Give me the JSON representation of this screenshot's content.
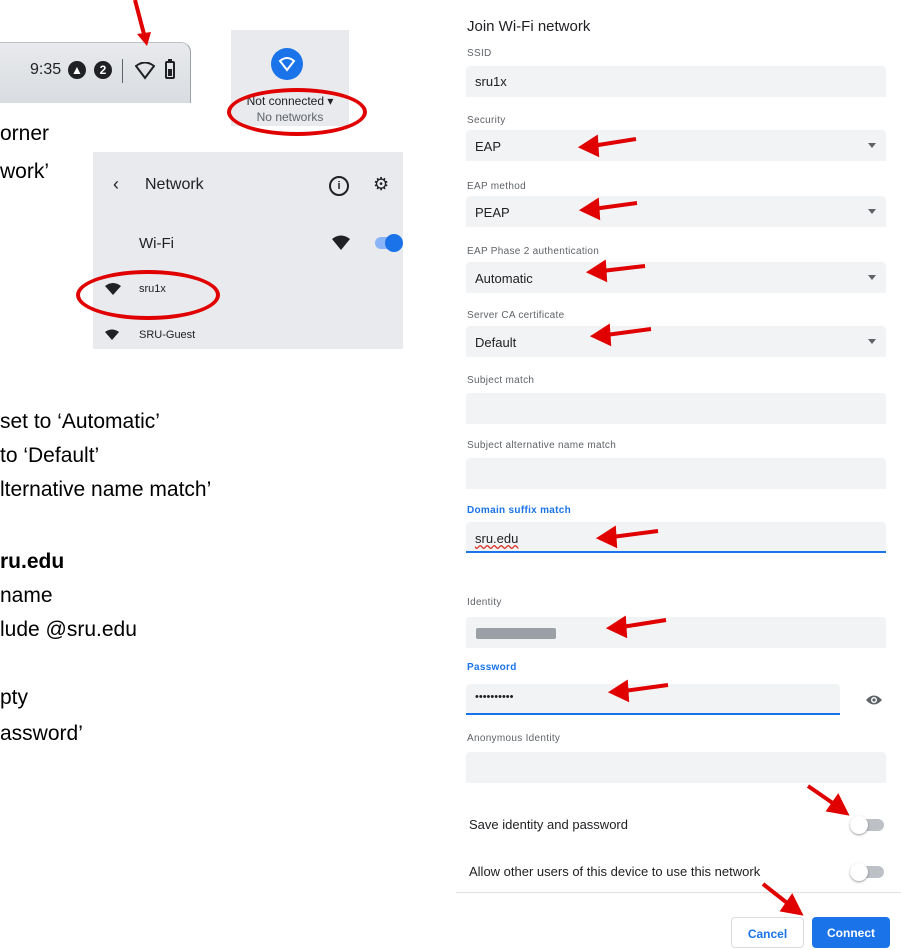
{
  "tray": {
    "time": "9:35",
    "badge1": "",
    "badge2": "2"
  },
  "popover": {
    "status": "Not connected",
    "sub": "No networks"
  },
  "network_panel": {
    "title": "Network",
    "wifi_label": "Wi-Fi",
    "networks": [
      "sru1x",
      "SRU-Guest"
    ]
  },
  "instructions": [
    "orner",
    "work’",
    "set to ‘Automatic’",
    " to ‘Default’",
    "lternative name match’",
    "ru.edu",
    "name",
    "lude @sru.edu",
    "pty",
    "assword’"
  ],
  "dialog": {
    "title": "Join Wi-Fi network",
    "ssid_label": "SSID",
    "ssid_value": "sru1x",
    "security_label": "Security",
    "security_value": "EAP",
    "eap_method_label": "EAP method",
    "eap_method_value": "PEAP",
    "phase2_label": "EAP Phase 2 authentication",
    "phase2_value": "Automatic",
    "ca_label": "Server CA certificate",
    "ca_value": "Default",
    "subject_match_label": "Subject match",
    "subject_alt_label": "Subject alternative name match",
    "domain_suffix_label": "Domain suffix match",
    "domain_suffix_value": "sru.edu",
    "identity_label": "Identity",
    "password_label": "Password",
    "password_value": "••••••••••",
    "anon_identity_label": "Anonymous Identity",
    "save_label": "Save identity and password",
    "allow_label": "Allow other users of this device to use this network",
    "cancel_label": "Cancel",
    "connect_label": "Connect"
  },
  "colors": {
    "accent": "#1a73e8",
    "annotation_red": "#e00000"
  }
}
